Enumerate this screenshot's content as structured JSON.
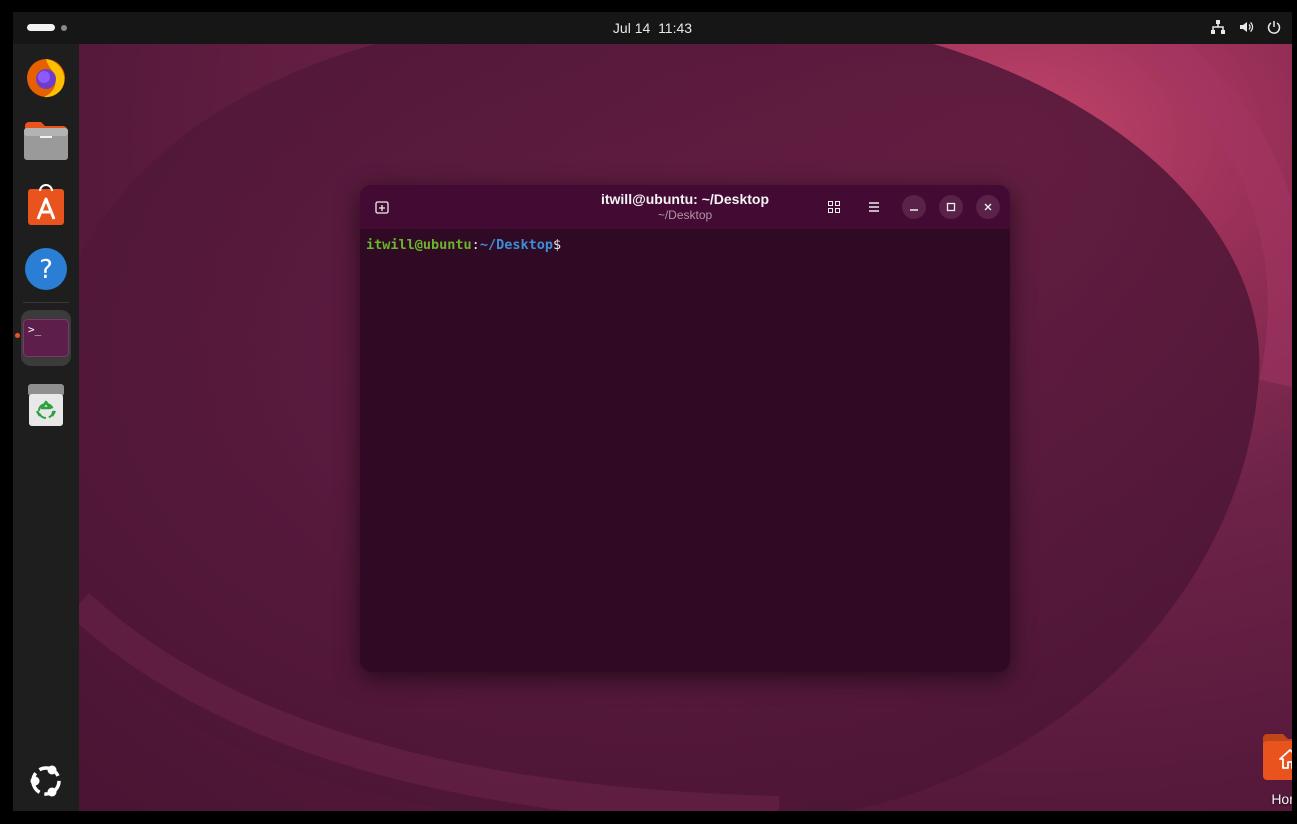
{
  "topbar": {
    "clock_date": "Jul 14",
    "clock_time": "11:43",
    "tray_icons": [
      "network-icon",
      "volume-icon",
      "power-icon"
    ]
  },
  "dock": {
    "items": [
      {
        "name": "Firefox",
        "icon": "firefox-icon"
      },
      {
        "name": "Files",
        "icon": "files-icon"
      },
      {
        "name": "App Center",
        "icon": "app-center-icon"
      },
      {
        "name": "Help",
        "icon": "help-icon"
      },
      {
        "name": "Terminal",
        "icon": "terminal-icon",
        "running": true,
        "active": true
      },
      {
        "name": "Trash",
        "icon": "trash-icon"
      }
    ],
    "show_apps_icon": "ubuntu-logo-icon"
  },
  "terminal": {
    "title": "itwill@ubuntu: ~/Desktop",
    "subtitle": "~/Desktop",
    "prompt_user": "itwill@ubuntu",
    "prompt_colon": ":",
    "prompt_path": "~/Desktop",
    "prompt_symbol": "$",
    "colors": {
      "background": "#300a24",
      "header": "#430b34",
      "user": "#6ab52a",
      "path": "#3a8fd6"
    }
  },
  "desktop": {
    "home_label": "Home",
    "home_icon": "home-folder-icon"
  }
}
